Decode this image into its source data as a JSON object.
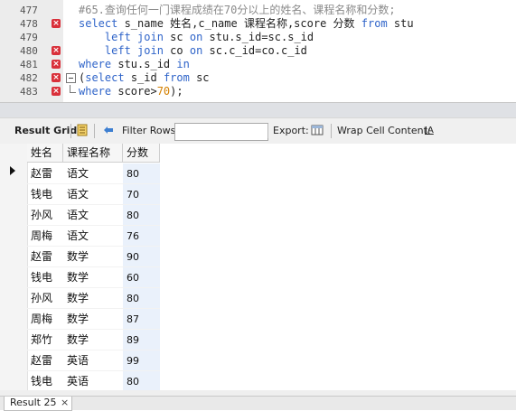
{
  "editor": {
    "lines": [
      {
        "num": "477",
        "marker": "none",
        "fold": "none",
        "segments": [
          {
            "t": "cm",
            "v": "#65.查询任何一门课程成绩在70分以上的姓名、课程名称和分数;"
          }
        ]
      },
      {
        "num": "478",
        "marker": "error",
        "fold": "none",
        "segments": [
          {
            "t": "kw",
            "v": "select"
          },
          {
            "t": "tx",
            "v": " s_name 姓名,c_name 课程名称,score 分数 "
          },
          {
            "t": "kw",
            "v": "from"
          },
          {
            "t": "tx",
            "v": " stu"
          }
        ]
      },
      {
        "num": "479",
        "marker": "none",
        "fold": "none",
        "segments": [
          {
            "t": "tx",
            "v": "    "
          },
          {
            "t": "kw",
            "v": "left join"
          },
          {
            "t": "tx",
            "v": " sc "
          },
          {
            "t": "kw",
            "v": "on"
          },
          {
            "t": "tx",
            "v": " stu.s_id=sc.s_id"
          }
        ]
      },
      {
        "num": "480",
        "marker": "error",
        "fold": "none",
        "segments": [
          {
            "t": "tx",
            "v": "    "
          },
          {
            "t": "kw",
            "v": "left join"
          },
          {
            "t": "tx",
            "v": " co "
          },
          {
            "t": "kw",
            "v": "on"
          },
          {
            "t": "tx",
            "v": " sc.c_id=co.c_id"
          }
        ]
      },
      {
        "num": "481",
        "marker": "error",
        "fold": "none",
        "segments": [
          {
            "t": "kw",
            "v": "where"
          },
          {
            "t": "tx",
            "v": " stu.s_id "
          },
          {
            "t": "kw",
            "v": "in"
          }
        ]
      },
      {
        "num": "482",
        "marker": "error",
        "fold": "open",
        "segments": [
          {
            "t": "tx",
            "v": "("
          },
          {
            "t": "kw",
            "v": "select"
          },
          {
            "t": "tx",
            "v": " s_id "
          },
          {
            "t": "kw",
            "v": "from"
          },
          {
            "t": "tx",
            "v": " sc"
          }
        ]
      },
      {
        "num": "483",
        "marker": "error",
        "fold": "end",
        "segments": [
          {
            "t": "kw",
            "v": "where"
          },
          {
            "t": "tx",
            "v": " score>"
          },
          {
            "t": "num",
            "v": "70"
          },
          {
            "t": "tx",
            "v": ");"
          }
        ]
      }
    ]
  },
  "toolbar": {
    "result_grid": "Result Grid",
    "filter_rows": "Filter Rows:",
    "filter_value": "",
    "export": "Export:",
    "wrap": "Wrap Cell Content:",
    "wrap_icon_text": "IA"
  },
  "grid": {
    "columns": [
      "姓名",
      "课程名称",
      "分数"
    ],
    "rows": [
      [
        "赵雷",
        "语文",
        "80"
      ],
      [
        "钱电",
        "语文",
        "70"
      ],
      [
        "孙风",
        "语文",
        "80"
      ],
      [
        "周梅",
        "语文",
        "76"
      ],
      [
        "赵雷",
        "数学",
        "90"
      ],
      [
        "钱电",
        "数学",
        "60"
      ],
      [
        "孙风",
        "数学",
        "80"
      ],
      [
        "周梅",
        "数学",
        "87"
      ],
      [
        "郑竹",
        "数学",
        "89"
      ],
      [
        "赵雷",
        "英语",
        "99"
      ],
      [
        "钱电",
        "英语",
        "80"
      ],
      [
        "孙风",
        "英语",
        "80"
      ]
    ]
  },
  "bottom": {
    "tab_label": "Result 25",
    "close": "×"
  },
  "colors": {
    "keyword": "#2f64c9",
    "comment": "#8a8a8a",
    "error_marker": "#d9303a",
    "selected_column": "#eaf1fb"
  }
}
